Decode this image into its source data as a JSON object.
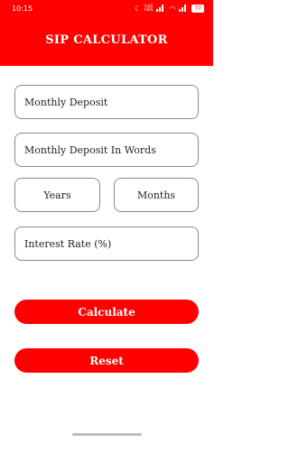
{
  "status_bar": {
    "time": "10:15",
    "net_speed_value": "0.00",
    "net_speed_unit": "KB/S",
    "battery": "77"
  },
  "header": {
    "title": "SIP CALCULATOR"
  },
  "form": {
    "monthly_deposit": "Monthly Deposit",
    "monthly_deposit_words": "Monthly Deposit In Words",
    "years": "Years",
    "months": "Months",
    "interest_rate": "Interest Rate (%)"
  },
  "buttons": {
    "calculate": "Calculate",
    "reset": "Reset"
  },
  "colors": {
    "accent": "#ff0000",
    "border": "#8a8a8a"
  },
  "icons": [
    "moon-icon",
    "signal-icon",
    "wifi-icon",
    "battery-icon"
  ]
}
